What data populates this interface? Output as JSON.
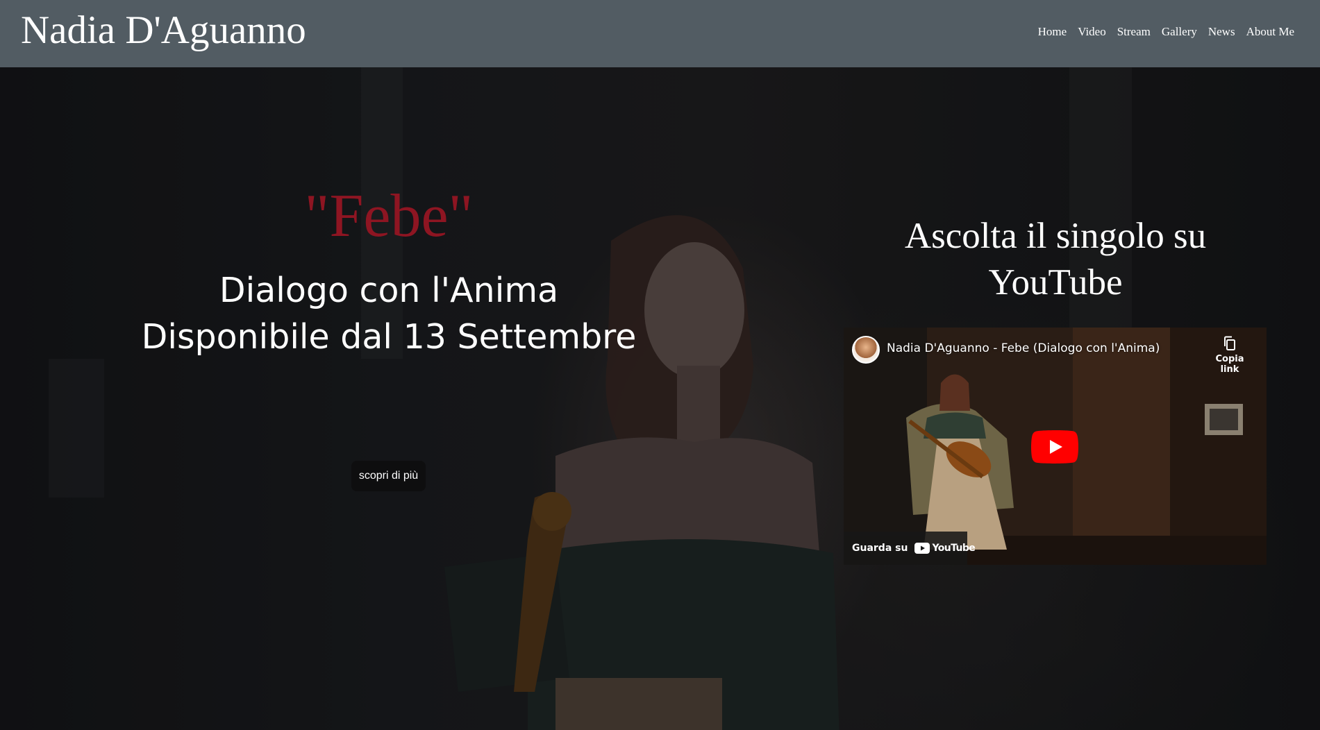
{
  "site": {
    "brand": "Nadia D'Aguanno",
    "nav": [
      "Home",
      "Video",
      "Stream",
      "Gallery",
      "News",
      "About Me"
    ]
  },
  "hero": {
    "title": "\"Febe\"",
    "subtitle_line1": "Dialogo con l'Anima",
    "subtitle_line2": "Disponibile dal 13 Settembre",
    "cta_label": "scopri di più"
  },
  "listen": {
    "heading": "Ascolta il singolo su YouTube",
    "video": {
      "title": "Nadia D'Aguanno - Febe (Dialogo con l'Anima)",
      "copy_link_label": "Copia link",
      "watch_on_label": "Guarda su",
      "platform_label": "YouTube"
    }
  },
  "colors": {
    "header_bg": "#525c63",
    "title_red": "#8e1522",
    "youtube_red": "#ff0000",
    "button_bg": "#0e0e0f"
  },
  "icons": {
    "copy": "copy-link-icon",
    "play": "play-button-icon",
    "youtube": "youtube-logo-icon"
  }
}
